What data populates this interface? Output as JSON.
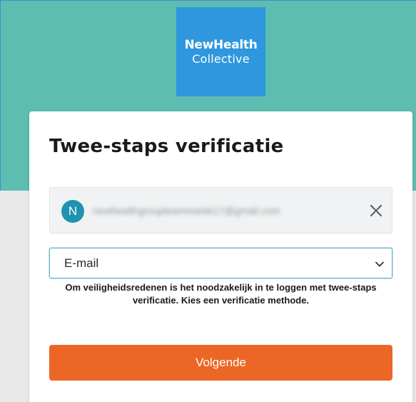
{
  "logo": {
    "line1": "NewHealth",
    "line2": "Collective"
  },
  "title": "Twee-staps verificatie",
  "account": {
    "initial": "N",
    "email": "newhealthgroupteammarkk17@gmail.com"
  },
  "method": {
    "selected": "E-mail"
  },
  "notice": "Om veiligheidsredenen is het noodzakelijk in te loggen met twee-staps verificatie. Kies een verificatie methode.",
  "next_label": "Volgende",
  "colors": {
    "teal": "#5dbdb1",
    "logo_blue": "#2e97de",
    "avatar": "#1f93b0",
    "button": "#ec6625"
  },
  "icons": {
    "close": "close-icon",
    "chevron": "chevron-down-icon"
  }
}
